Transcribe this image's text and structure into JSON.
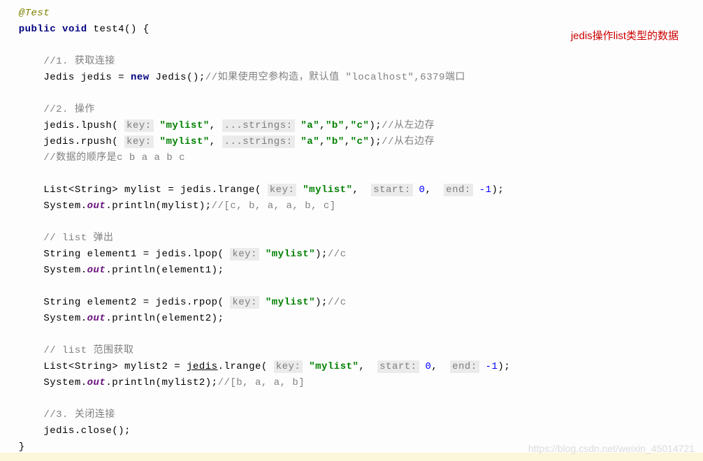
{
  "annotation": "@Test",
  "signature_kw1": "public",
  "signature_kw2": "void",
  "signature_name": " test4() {",
  "note_text": "jedis操作list类型的数据",
  "c1": "//1. 获取连接",
  "l1_a": "Jedis jedis = ",
  "l1_new": "new",
  "l1_b": " Jedis();",
  "l1_c": "//如果使用空参构造，默认值 \"localhost\",6379端口",
  "c2": "//2. 操作",
  "l2_a": "jedis.lpush( ",
  "hint_key": "key:",
  "l2_key": " \"mylist\"",
  "l2_comma": ", ",
  "hint_strings": "...strings:",
  "l2_vals_a": " \"a\"",
  "l2_sep": ",",
  "l2_vals_b": "\"b\"",
  "l2_vals_c": "\"c\"",
  "l2_end": ");",
  "l2_cmt": "//从左边存",
  "l3_a": "jedis.rpush( ",
  "l3_cmt": "//从右边存",
  "c_order": "//数据的顺序是c b a a b c",
  "l4_a": "List<String> mylist = jedis.lrange( ",
  "hint_start": "start:",
  "hint_end": "end:",
  "num_0": " 0",
  "num_neg1": " -1",
  "l4_end": ");",
  "l5_a": "System.",
  "l5_out": "out",
  "l5_b": ".println(mylist);",
  "l5_cmt": "//[c, b, a, a, b, c]",
  "c_pop": "// list 弹出",
  "l6_a": "String element1 = jedis.lpop( ",
  "l6_end": ");",
  "l6_cmt": "//c",
  "l7_b": ".println(element1);",
  "l8_a": "String element2 = jedis.rpop( ",
  "l9_b": ".println(element2);",
  "c_range": "// list 范围获取",
  "l10_a": "List<String> mylist2 = ",
  "l10_jedis": "jedis",
  "l10_b": ".lrange( ",
  "l11_b": ".println(mylist2);",
  "l11_cmt": "//[b, a, a, b]",
  "c3": "//3. 关闭连接",
  "l12_a": "jedis.close();",
  "close_brace": "}",
  "watermark": "https://blog.csdn.net/weixin_45014721"
}
